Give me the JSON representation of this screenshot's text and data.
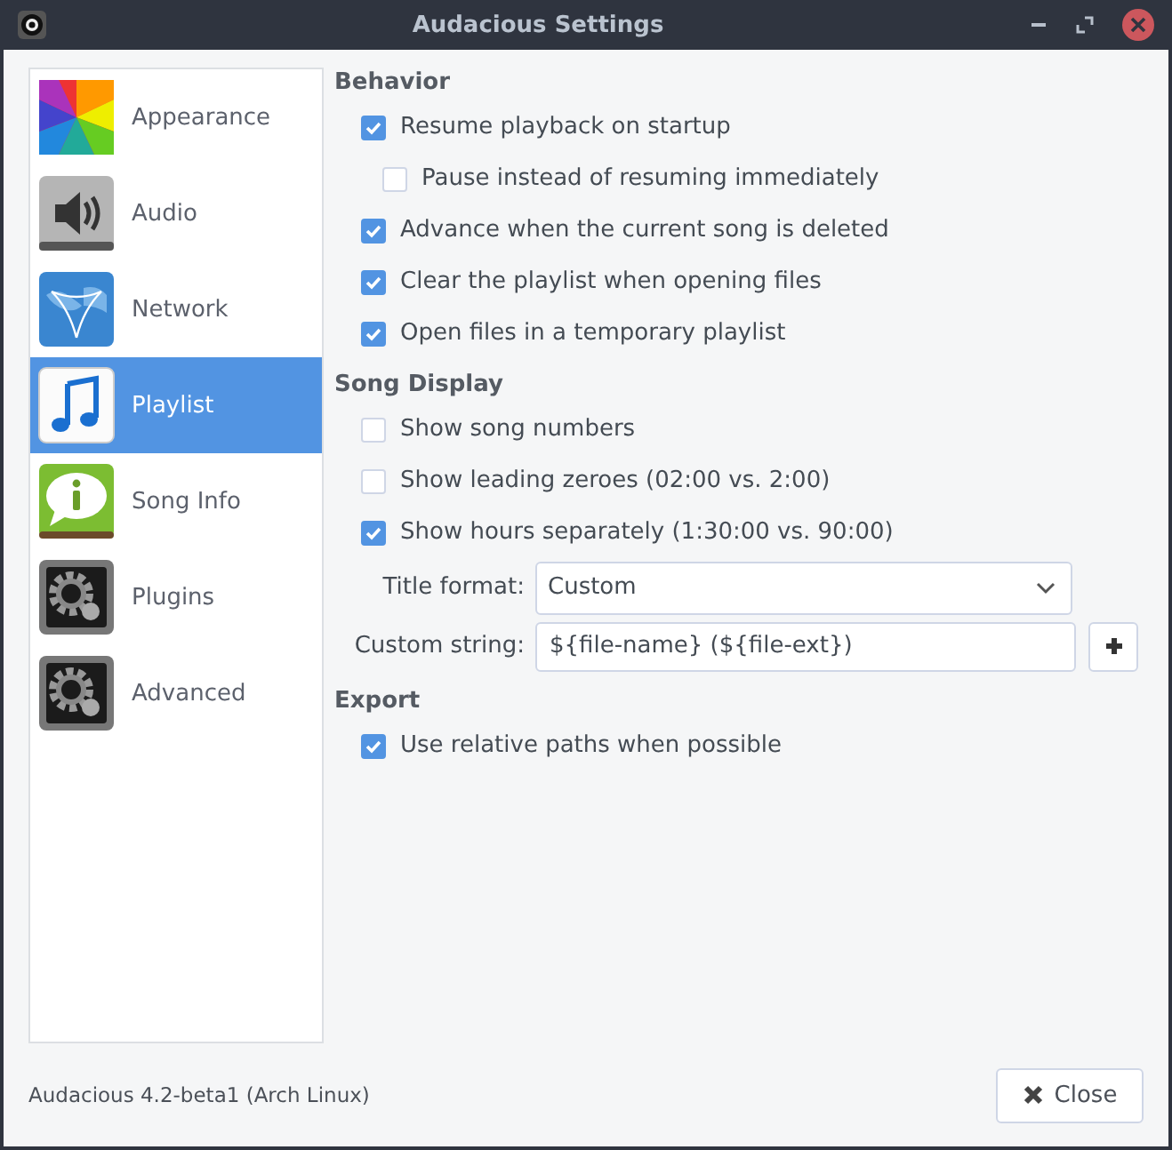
{
  "window": {
    "title": "Audacious Settings"
  },
  "sidebar": {
    "items": [
      {
        "label": "Appearance",
        "selected": false
      },
      {
        "label": "Audio",
        "selected": false
      },
      {
        "label": "Network",
        "selected": false
      },
      {
        "label": "Playlist",
        "selected": true
      },
      {
        "label": "Song Info",
        "selected": false
      },
      {
        "label": "Plugins",
        "selected": false
      },
      {
        "label": "Advanced",
        "selected": false
      }
    ]
  },
  "sections": [
    {
      "heading": "Behavior",
      "items": [
        {
          "kind": "checkbox",
          "label": "Resume playback on startup",
          "checked": true,
          "children": [
            {
              "kind": "checkbox",
              "label": "Pause instead of resuming immediately",
              "checked": false
            }
          ]
        },
        {
          "kind": "checkbox",
          "label": "Advance when the current song is deleted",
          "checked": true
        },
        {
          "kind": "checkbox",
          "label": "Clear the playlist when opening files",
          "checked": true
        },
        {
          "kind": "checkbox",
          "label": "Open files in a temporary playlist",
          "checked": true
        }
      ]
    },
    {
      "heading": "Song Display",
      "items": [
        {
          "kind": "checkbox",
          "label": "Show song numbers",
          "checked": false
        },
        {
          "kind": "checkbox",
          "label": "Show leading zeroes (02:00 vs. 2:00)",
          "checked": false
        },
        {
          "kind": "checkbox",
          "label": "Show hours separately (1:30:00 vs. 90:00)",
          "checked": true
        },
        {
          "kind": "dropdown",
          "label": "Title format:",
          "value": "Custom"
        },
        {
          "kind": "text",
          "label": "Custom string:",
          "value": "${file-name} (${file-ext})"
        }
      ]
    },
    {
      "heading": "Export",
      "items": [
        {
          "kind": "checkbox",
          "label": "Use relative paths when possible",
          "checked": true
        }
      ]
    }
  ],
  "footer": {
    "version": "Audacious 4.2-beta1 (Arch Linux)",
    "close_button": "Close"
  }
}
